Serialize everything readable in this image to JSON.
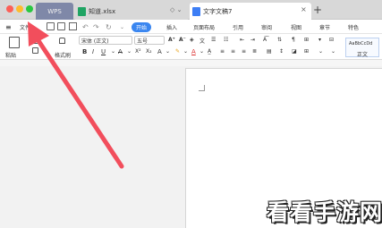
{
  "tabs": [
    {
      "label": "WPS"
    },
    {
      "label": "知道.xlsx"
    },
    {
      "label": "文字文稿7"
    }
  ],
  "new_tab": "+",
  "menu": {
    "file": "文件",
    "items": [
      "开始",
      "插入",
      "页面布局",
      "引用",
      "审阅",
      "视图",
      "章节",
      "特色"
    ],
    "selected": "开始"
  },
  "ribbon": {
    "paste": "粘贴",
    "format_painter": "格式刷",
    "font": "宋体 (正文)",
    "size": "五号",
    "style_sample": "AaBbCcDd",
    "style_name": "正文"
  },
  "watermark": "看看手游网",
  "colors": {
    "accent": "#3a86f0",
    "arrow": "#f24e5c"
  }
}
